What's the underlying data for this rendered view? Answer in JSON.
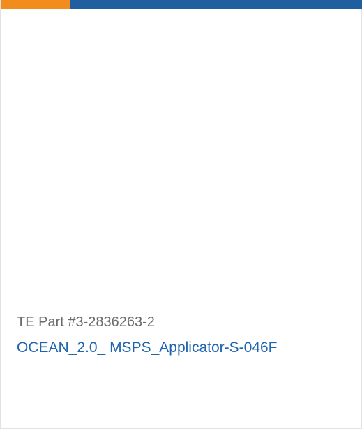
{
  "accent_colors": {
    "orange": "#f28c1c",
    "blue": "#1f5fa0",
    "link": "#1f64ad"
  },
  "product": {
    "part_number": "TE Part #3-2836263-2",
    "name": "OCEAN_2.0_ MSPS_Applicator-S-046F"
  }
}
